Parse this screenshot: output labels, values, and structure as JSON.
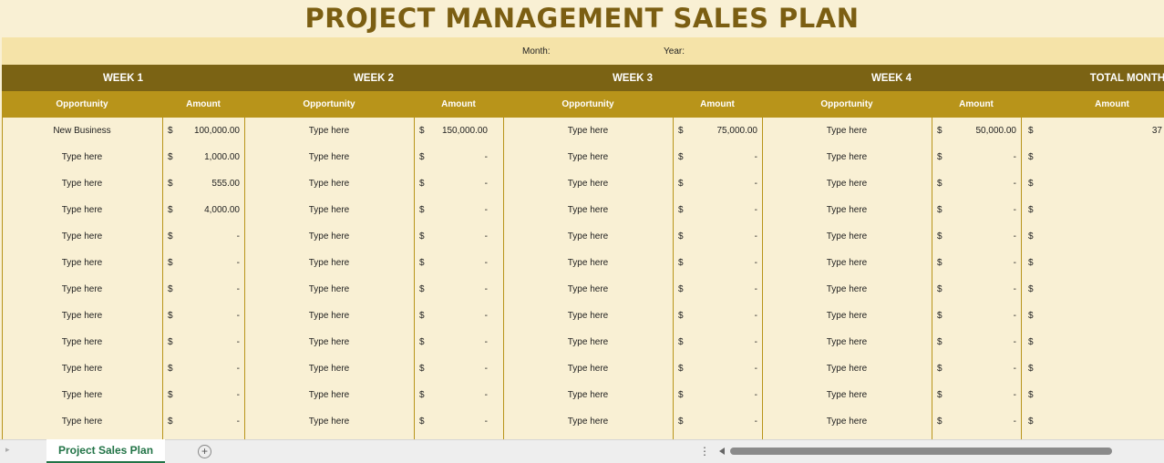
{
  "title": "PROJECT MANAGEMENT SALES PLAN",
  "month_label": "Month:",
  "year_label": "Year:",
  "weeks": [
    "WEEK 1",
    "WEEK 2",
    "WEEK 3",
    "WEEK 4",
    "TOTAL MONTH"
  ],
  "col_opportunity": "Opportunity",
  "col_amount": "Amount",
  "dollar": "$",
  "rows": [
    {
      "w1_opp": "New Business",
      "w1_amt": "100,000.00",
      "w2_opp": "Type here",
      "w2_amt": "150,000.00",
      "w3_opp": "Type here",
      "w3_amt": "75,000.00",
      "w4_opp": "Type here",
      "w4_amt": "50,000.00",
      "total": "37"
    },
    {
      "w1_opp": "Type here",
      "w1_amt": "1,000.00",
      "w2_opp": "Type here",
      "w2_amt": "-",
      "w3_opp": "Type here",
      "w3_amt": "-",
      "w4_opp": "Type here",
      "w4_amt": "-",
      "total": ""
    },
    {
      "w1_opp": "Type here",
      "w1_amt": "555.00",
      "w2_opp": "Type here",
      "w2_amt": "-",
      "w3_opp": "Type here",
      "w3_amt": "-",
      "w4_opp": "Type here",
      "w4_amt": "-",
      "total": ""
    },
    {
      "w1_opp": "Type here",
      "w1_amt": "4,000.00",
      "w2_opp": "Type here",
      "w2_amt": "-",
      "w3_opp": "Type here",
      "w3_amt": "-",
      "w4_opp": "Type here",
      "w4_amt": "-",
      "total": ""
    },
    {
      "w1_opp": "Type here",
      "w1_amt": "-",
      "w2_opp": "Type here",
      "w2_amt": "-",
      "w3_opp": "Type here",
      "w3_amt": "-",
      "w4_opp": "Type here",
      "w4_amt": "-",
      "total": ""
    },
    {
      "w1_opp": "Type here",
      "w1_amt": "-",
      "w2_opp": "Type here",
      "w2_amt": "-",
      "w3_opp": "Type here",
      "w3_amt": "-",
      "w4_opp": "Type here",
      "w4_amt": "-",
      "total": ""
    },
    {
      "w1_opp": "Type here",
      "w1_amt": "-",
      "w2_opp": "Type here",
      "w2_amt": "-",
      "w3_opp": "Type here",
      "w3_amt": "-",
      "w4_opp": "Type here",
      "w4_amt": "-",
      "total": ""
    },
    {
      "w1_opp": "Type here",
      "w1_amt": "-",
      "w2_opp": "Type here",
      "w2_amt": "-",
      "w3_opp": "Type here",
      "w3_amt": "-",
      "w4_opp": "Type here",
      "w4_amt": "-",
      "total": ""
    },
    {
      "w1_opp": "Type here",
      "w1_amt": "-",
      "w2_opp": "Type here",
      "w2_amt": "-",
      "w3_opp": "Type here",
      "w3_amt": "-",
      "w4_opp": "Type here",
      "w4_amt": "-",
      "total": ""
    },
    {
      "w1_opp": "Type here",
      "w1_amt": "-",
      "w2_opp": "Type here",
      "w2_amt": "-",
      "w3_opp": "Type here",
      "w3_amt": "-",
      "w4_opp": "Type here",
      "w4_amt": "-",
      "total": ""
    },
    {
      "w1_opp": "Type here",
      "w1_amt": "-",
      "w2_opp": "Type here",
      "w2_amt": "-",
      "w3_opp": "Type here",
      "w3_amt": "-",
      "w4_opp": "Type here",
      "w4_amt": "-",
      "total": ""
    },
    {
      "w1_opp": "Type here",
      "w1_amt": "-",
      "w2_opp": "Type here",
      "w2_amt": "-",
      "w3_opp": "Type here",
      "w3_amt": "-",
      "w4_opp": "Type here",
      "w4_amt": "-",
      "total": ""
    }
  ],
  "sheet_tab": "Project Sales Plan",
  "add_sheet_symbol": "+",
  "more_symbol": "⋮",
  "colors": {
    "title": "#7b5e12",
    "week_header": "#7b6314",
    "sub_header": "#b8941a",
    "cell_bg": "#f9f0d4",
    "tab_accent": "#217346"
  }
}
